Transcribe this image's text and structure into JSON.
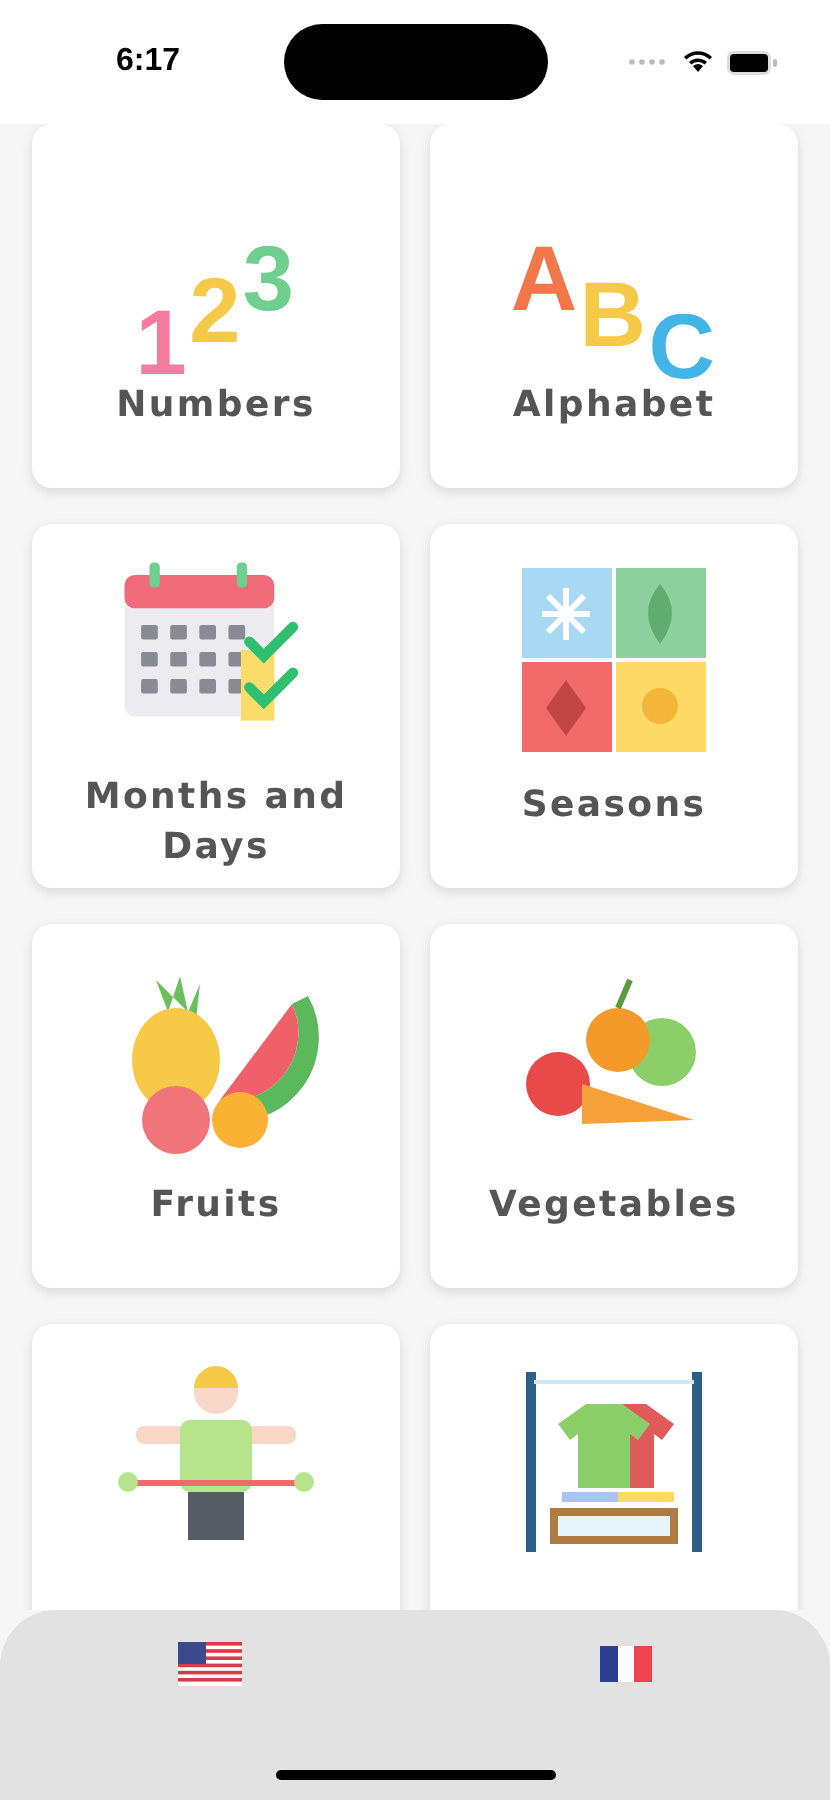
{
  "status_bar": {
    "time": "6:17"
  },
  "cards": [
    {
      "kind": "glyphs",
      "label": "Numbers",
      "glyphs": [
        {
          "text": "1",
          "color": "#f47ca0"
        },
        {
          "text": "2",
          "color": "#f7c948"
        },
        {
          "text": "3",
          "color": "#6fcf8e"
        }
      ]
    },
    {
      "kind": "glyphs",
      "label": "Alphabet",
      "glyphs": [
        {
          "text": "A",
          "color": "#f2774a"
        },
        {
          "text": "B",
          "color": "#f7c948"
        },
        {
          "text": "C",
          "color": "#43b4e6"
        }
      ]
    },
    {
      "kind": "icon",
      "label": "Months and Days"
    },
    {
      "kind": "icon",
      "label": "Seasons"
    },
    {
      "kind": "icon",
      "label": "Fruits"
    },
    {
      "kind": "icon",
      "label": "Vegetables"
    },
    {
      "kind": "icon"
    },
    {
      "kind": "icon"
    }
  ]
}
